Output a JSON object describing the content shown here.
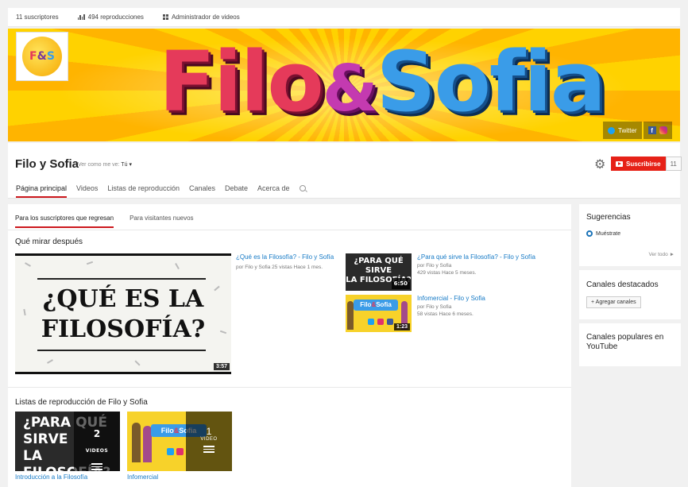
{
  "topbar": {
    "subscribers": "11 suscriptores",
    "views": "494 reproducciones",
    "video_manager": "Administrador de videos"
  },
  "banner": {
    "title_filo": "Filo",
    "title_amp": "&",
    "title_sofia": "Sofia",
    "avatar_f": "F",
    "avatar_amp": "&",
    "avatar_s": "S",
    "twitter_label": "Twitter",
    "facebook_glyph": "f"
  },
  "channel": {
    "name": "Filo y Sofia",
    "view_as_label": "Ver como me ve:",
    "view_as_value": "Tú ▾",
    "subscribe_label": "Suscribirse",
    "subscribe_count": "11"
  },
  "tabs": [
    "Página principal",
    "Videos",
    "Listas de reproducción",
    "Canales",
    "Debate",
    "Acerca de"
  ],
  "subtabs": [
    "Para los suscriptores que regresan",
    "Para visitantes nuevos"
  ],
  "whats_next": {
    "title": "Qué mirar después",
    "featured": {
      "thumb_line1": "¿QUÉ ES LA",
      "thumb_line2": "FILOSOFÍA?",
      "duration": "3:57",
      "title": "¿Qué es la Filosofía? - Filo y Sofía",
      "meta": "por Filo y Sofia   25 vistas   Hace 1 mes."
    },
    "videos": [
      {
        "title": "¿Para qué sirve la Filosofía? - Filo y Sofía",
        "by": "por Filo y Sofia",
        "stats": "429 vistas   Hace 5 meses.",
        "duration": "6:50",
        "thumb_l1": "¿PARA QUÉ",
        "thumb_l2": "SIRVE",
        "thumb_l3": "LA FILOSOFÍA?"
      },
      {
        "title": "Infomercial - Filo y Sofia",
        "by": "por Filo y Sofia",
        "stats": "58 vistas   Hace 6 meses.",
        "duration": "1:23",
        "thumb_logo_a": "Filo",
        "thumb_logo_b": "&",
        "thumb_logo_c": "Sofia"
      }
    ]
  },
  "playlists": {
    "title": "Listas de reproducción de Filo y Sofia",
    "items": [
      {
        "title": "Introducción a la Filosofía",
        "count": "2",
        "unit": "VIDEOS",
        "thumb_l1": "¿PARA QUÉ",
        "thumb_l2": "SIRVE",
        "thumb_l3": "LA FILOSOFÍA?"
      },
      {
        "title": "Infomercial",
        "count": "1",
        "unit": "VIDEO",
        "thumb_logo_a": "Filo",
        "thumb_logo_b": "&",
        "thumb_logo_c": "Sofia"
      }
    ]
  },
  "sidebar": {
    "suggestions_title": "Sugerencias",
    "suggestion_item": "Muéstrate",
    "see_all": "Ver todo ►",
    "featured_channels_title": "Canales destacados",
    "add_channels": "+ Agregar canales",
    "popular_title": "Canales populares en YouTube"
  },
  "colors": {
    "accent_red": "#cc181e",
    "subscribe_red": "#e62117",
    "link_blue": "#167ac6",
    "banner_yellow": "#ffd200"
  }
}
